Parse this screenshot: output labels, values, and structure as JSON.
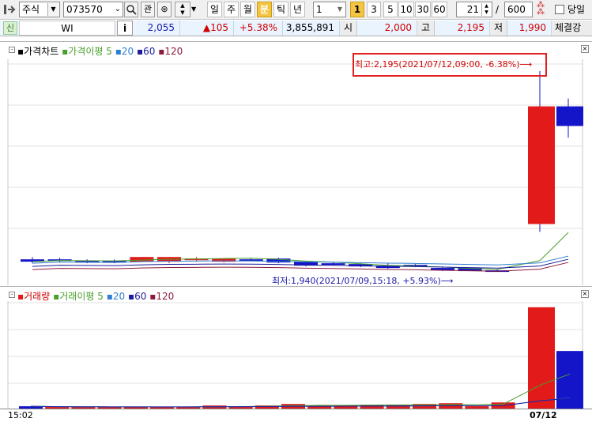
{
  "toolbar": {
    "market": "주식",
    "code": "073570",
    "search_icon": "magnifier-icon",
    "watch_label": "관",
    "periods": [
      "일",
      "주",
      "월",
      "분",
      "틱",
      "년"
    ],
    "active_period": "분",
    "interval_value": "1",
    "minute_buttons": [
      "1",
      "3",
      "5",
      "10",
      "30",
      "60"
    ],
    "active_minute": "1",
    "count_value": "21",
    "slash": "/",
    "max_value": "600",
    "today_label": "당일"
  },
  "quote_bar": {
    "tag": "신",
    "name": "WI",
    "info_button": "i",
    "price": "2,055",
    "change": "▲105",
    "change_pct": "+5.38%",
    "volume": "3,855,891",
    "open_label": "시",
    "open_value": "2,000",
    "high_label": "고",
    "high_value": "2,195",
    "low_label": "저",
    "low_value": "1,990",
    "trade_label": "체결강"
  },
  "price_panel": {
    "legend_title": "가격차트",
    "legend_ma_title": "가격이평",
    "legend_periods": [
      "5",
      "20",
      "60",
      "120"
    ],
    "high_annotation": "최고:2,195(2021/07/12,09:00, -6.38%)⟶",
    "low_annotation": "최저:1,940(2021/07/09,15:18, +5.93%)⟶"
  },
  "volume_panel": {
    "legend_title": "거래량",
    "legend_ma_title": "거래이평",
    "legend_periods": [
      "5",
      "20",
      "60",
      "120"
    ]
  },
  "xaxis": {
    "left_label": "15:02",
    "date_label": "07/12"
  },
  "colors": {
    "up": "#e31a1a",
    "down": "#1414c8",
    "ma5": "#4aa02c",
    "ma20": "#2f7fd0",
    "ma60": "#1c1c9c",
    "ma120": "#8c1a3a",
    "up_text": "#d00000",
    "accent": "#f4c542"
  },
  "chart_data": {
    "type": "candlestick",
    "candles": [
      {
        "o": 1955,
        "h": 1958,
        "l": 1950,
        "c": 1952,
        "dir": "down"
      },
      {
        "o": 1955,
        "h": 1957,
        "l": 1951,
        "c": 1955,
        "dir": "down"
      },
      {
        "o": 1953,
        "h": 1955,
        "l": 1950,
        "c": 1953,
        "dir": "down"
      },
      {
        "o": 1953,
        "h": 1955,
        "l": 1950,
        "c": 1952,
        "dir": "down"
      },
      {
        "o": 1952,
        "h": 1958,
        "l": 1952,
        "c": 1958,
        "dir": "up"
      },
      {
        "o": 1952,
        "h": 1958,
        "l": 1950,
        "c": 1958,
        "dir": "up"
      },
      {
        "o": 1955,
        "h": 1958,
        "l": 1953,
        "c": 1956,
        "dir": "up"
      },
      {
        "o": 1952,
        "h": 1956,
        "l": 1951,
        "c": 1956,
        "dir": "up"
      },
      {
        "o": 1955,
        "h": 1956,
        "l": 1953,
        "c": 1954,
        "dir": "down"
      },
      {
        "o": 1956,
        "h": 1957,
        "l": 1950,
        "c": 1951,
        "dir": "down"
      },
      {
        "o": 1952,
        "h": 1953,
        "l": 1946,
        "c": 1947,
        "dir": "down"
      },
      {
        "o": 1950,
        "h": 1952,
        "l": 1947,
        "c": 1949,
        "dir": "down"
      },
      {
        "o": 1949,
        "h": 1950,
        "l": 1945,
        "c": 1946,
        "dir": "down"
      },
      {
        "o": 1947,
        "h": 1950,
        "l": 1943,
        "c": 1944,
        "dir": "down"
      },
      {
        "o": 1948,
        "h": 1949,
        "l": 1945,
        "c": 1946,
        "dir": "down"
      },
      {
        "o": 1944,
        "h": 1945,
        "l": 1940,
        "c": 1941,
        "dir": "down"
      },
      {
        "o": 1944,
        "h": 1944,
        "l": 1940,
        "c": 1940,
        "dir": "down"
      },
      {
        "o": 1941,
        "h": 1942,
        "l": 1940,
        "c": 1940,
        "dir": "down"
      },
      {
        "o": 2150,
        "h": 2195,
        "l": 1990,
        "c": 2000,
        "dir": "down"
      },
      {
        "o": 2150,
        "h": 2160,
        "l": 2110,
        "c": 2125,
        "dir": "down"
      }
    ],
    "volumes": [
      {
        "v": 3,
        "dir": "down"
      },
      {
        "v": 2,
        "dir": "up"
      },
      {
        "v": 2,
        "dir": "up"
      },
      {
        "v": 2,
        "dir": "up"
      },
      {
        "v": 2,
        "dir": "up"
      },
      {
        "v": 2,
        "dir": "up"
      },
      {
        "v": 2,
        "dir": "up"
      },
      {
        "v": 4,
        "dir": "up"
      },
      {
        "v": 3,
        "dir": "up"
      },
      {
        "v": 4,
        "dir": "up"
      },
      {
        "v": 6,
        "dir": "up"
      },
      {
        "v": 4,
        "dir": "up"
      },
      {
        "v": 4,
        "dir": "up"
      },
      {
        "v": 5,
        "dir": "up"
      },
      {
        "v": 5,
        "dir": "up"
      },
      {
        "v": 6,
        "dir": "up"
      },
      {
        "v": 7,
        "dir": "up"
      },
      {
        "v": 3,
        "dir": "up"
      },
      {
        "v": 8,
        "dir": "up"
      },
      {
        "v": 132,
        "dir": "up"
      },
      {
        "v": 75,
        "dir": "down"
      }
    ],
    "price_range": [
      1930,
      2210
    ],
    "volume_range": [
      0,
      140
    ],
    "grid": true
  }
}
